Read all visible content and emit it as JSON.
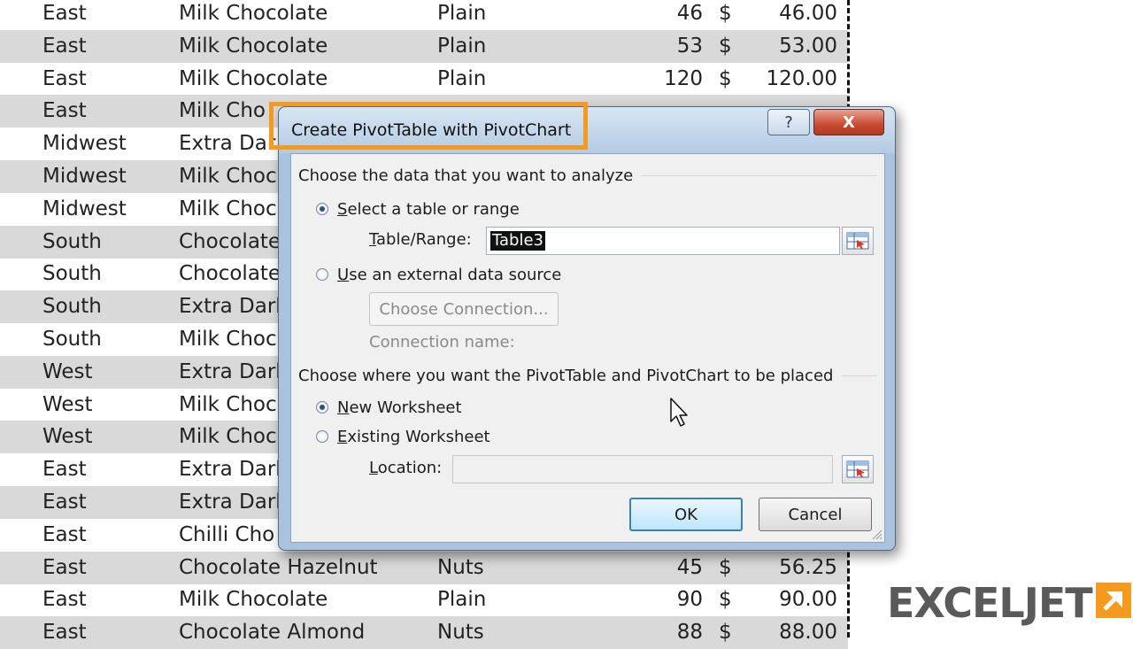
{
  "sheet": {
    "rows": [
      {
        "region": "East",
        "product": "Milk Chocolate",
        "type": "Plain",
        "qty": "46",
        "currency": "$",
        "amount": "46.00"
      },
      {
        "region": "East",
        "product": "Milk Chocolate",
        "type": "Plain",
        "qty": "53",
        "currency": "$",
        "amount": "53.00"
      },
      {
        "region": "East",
        "product": "Milk Chocolate",
        "type": "Plain",
        "qty": "120",
        "currency": "$",
        "amount": "120.00"
      },
      {
        "region": "East",
        "product": "Milk Cho",
        "type": "",
        "qty": "",
        "currency": "",
        "amount": ""
      },
      {
        "region": "Midwest",
        "product": "Extra Dar",
        "type": "",
        "qty": "",
        "currency": "",
        "amount": ""
      },
      {
        "region": "Midwest",
        "product": "Milk Choc",
        "type": "",
        "qty": "",
        "currency": "",
        "amount": ""
      },
      {
        "region": "Midwest",
        "product": "Milk Choc",
        "type": "",
        "qty": "",
        "currency": "",
        "amount": ""
      },
      {
        "region": "South",
        "product": "Chocolate",
        "type": "",
        "qty": "",
        "currency": "",
        "amount": ""
      },
      {
        "region": "South",
        "product": "Chocolate",
        "type": "",
        "qty": "",
        "currency": "",
        "amount": ""
      },
      {
        "region": "South",
        "product": "Extra Dark",
        "type": "",
        "qty": "",
        "currency": "",
        "amount": ""
      },
      {
        "region": "South",
        "product": "Milk Choc",
        "type": "",
        "qty": "",
        "currency": "",
        "amount": ""
      },
      {
        "region": "West",
        "product": "Extra Dark",
        "type": "",
        "qty": "",
        "currency": "",
        "amount": ""
      },
      {
        "region": "West",
        "product": "Milk Choc",
        "type": "",
        "qty": "",
        "currency": "",
        "amount": ""
      },
      {
        "region": "West",
        "product": "Milk Choc",
        "type": "",
        "qty": "",
        "currency": "",
        "amount": ""
      },
      {
        "region": "East",
        "product": "Extra Dark",
        "type": "",
        "qty": "",
        "currency": "",
        "amount": ""
      },
      {
        "region": "East",
        "product": "Extra Dark",
        "type": "",
        "qty": "",
        "currency": "",
        "amount": ""
      },
      {
        "region": "East",
        "product": "Chilli Cho",
        "type": "",
        "qty": "",
        "currency": "",
        "amount": ""
      },
      {
        "region": "East",
        "product": "Chocolate Hazelnut",
        "type": "Nuts",
        "qty": "45",
        "currency": "$",
        "amount": "56.25"
      },
      {
        "region": "East",
        "product": "Milk Chocolate",
        "type": "Plain",
        "qty": "90",
        "currency": "$",
        "amount": "90.00"
      },
      {
        "region": "East",
        "product": "Chocolate Almond",
        "type": "Nuts",
        "qty": "88",
        "currency": "$",
        "amount": "88.00"
      }
    ]
  },
  "dialog": {
    "title": "Create PivotTable with PivotChart",
    "help_glyph": "?",
    "close_glyph": "X",
    "section1": "Choose the data that you want to analyze",
    "radio_table_first": "S",
    "radio_table_rest": "elect a table or range",
    "table_range_label_first": "T",
    "table_range_label_rest": "able/Range:",
    "table_range_value": "Table3",
    "radio_external_first": "U",
    "radio_external_rest": "se an external data source",
    "choose_connection": "Choose Connection...",
    "connection_name_label": "Connection name:",
    "section2": "Choose where you want the PivotTable and PivotChart to be placed",
    "radio_new_first": "N",
    "radio_new_rest": "ew Worksheet",
    "radio_existing_first": "E",
    "radio_existing_rest": "xisting Worksheet",
    "location_label_first": "L",
    "location_label_rest": "ocation:",
    "location_value": "",
    "ok": "OK",
    "cancel": "Cancel"
  },
  "logo": {
    "text": "EXCELJET"
  },
  "colors": {
    "highlight": "#f59a1f",
    "row_shade": "#d9d9d9",
    "close_button": "#c84a32"
  }
}
